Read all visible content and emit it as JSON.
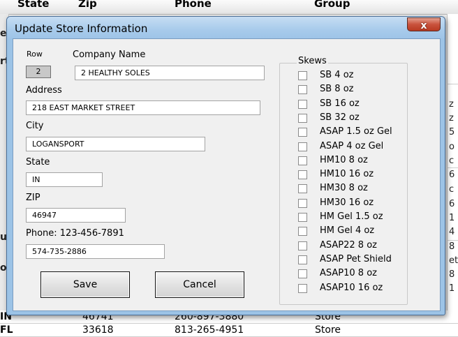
{
  "background": {
    "headers": [
      "State",
      "Zip",
      "Phone",
      "Group"
    ],
    "bottom_rows": [
      {
        "state": "IN",
        "zip": "46741",
        "phone": "260-897-3880",
        "group": "Store"
      },
      {
        "state": "FL",
        "zip": "33618",
        "phone": "813-265-4951",
        "group": "Store"
      }
    ],
    "left_cells": [
      "e",
      "rt",
      "ur",
      "ou"
    ],
    "right_cells": [
      "z",
      "z",
      "5",
      "o",
      "c",
      "6",
      "c",
      "6",
      "1",
      "4",
      "8",
      "et",
      "8",
      "1"
    ]
  },
  "dialog": {
    "title": "Update Store Information",
    "close_glyph": "x",
    "row": {
      "label": "Row",
      "value": "2"
    },
    "company": {
      "label": "Company Name",
      "value": "2 HEALTHY SOLES"
    },
    "address": {
      "label": "Address",
      "value": "218 EAST MARKET STREET"
    },
    "city": {
      "label": "City",
      "value": "LOGANSPORT"
    },
    "state": {
      "label": "State",
      "value": "IN"
    },
    "zip": {
      "label": "ZIP",
      "value": "46947"
    },
    "phone": {
      "label": "Phone: 123-456-7891",
      "value": "574-735-2886"
    },
    "save_label": "Save",
    "cancel_label": "Cancel",
    "skews": {
      "title": "Skews",
      "items": [
        {
          "label": "SB 4 oz",
          "checked": false
        },
        {
          "label": "SB 8 oz",
          "checked": false
        },
        {
          "label": "SB 16 oz",
          "checked": false
        },
        {
          "label": "SB 32 oz",
          "checked": false
        },
        {
          "label": "ASAP 1.5 oz Gel",
          "checked": false
        },
        {
          "label": "ASAP 4 oz Gel",
          "checked": false
        },
        {
          "label": "HM10 8 oz",
          "checked": false
        },
        {
          "label": "HM10 16 oz",
          "checked": false
        },
        {
          "label": "HM30 8 oz",
          "checked": false
        },
        {
          "label": "HM30 16 oz",
          "checked": false
        },
        {
          "label": "HM Gel 1.5 oz",
          "checked": false
        },
        {
          "label": "HM Gel 4 oz",
          "checked": false
        },
        {
          "label": "ASAP22 8 oz",
          "checked": false
        },
        {
          "label": "ASAP Pet Shield",
          "checked": false
        },
        {
          "label": "ASAP10 8 oz",
          "checked": false
        },
        {
          "label": "ASAP10 16 oz",
          "checked": false
        }
      ]
    }
  }
}
